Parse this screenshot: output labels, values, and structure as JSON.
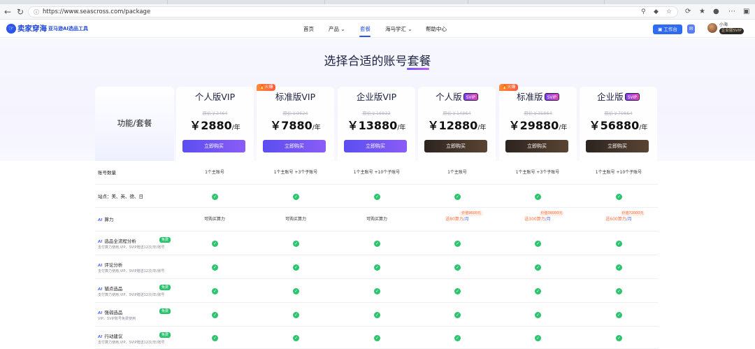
{
  "browser": {
    "url": "https://www.seascross.com/package",
    "icons": [
      "back-icon",
      "reload-icon",
      "site-info-icon",
      "zoom-icon",
      "extension-icon",
      "star-icon",
      "refresh-icon",
      "favorites-icon",
      "profile-icon",
      "more-icon",
      "sidebar-icon"
    ]
  },
  "header": {
    "logo_text": "卖家穿海",
    "logo_sub": "亚马逊AI选品工具",
    "nav": [
      {
        "label": "首页",
        "active": false
      },
      {
        "label": "产品",
        "active": false,
        "dropdown": true
      },
      {
        "label": "套餐",
        "active": true
      },
      {
        "label": "海马学汇",
        "active": false,
        "dropdown": true
      },
      {
        "label": "帮助中心",
        "active": false
      }
    ],
    "workbench_label": "工作台",
    "user_name": "小海",
    "user_badge": "企业版SVIP"
  },
  "page_title": "选择合适的账号套餐",
  "feature_header": "功能/套餐",
  "plans": [
    {
      "name": "个人版VIP",
      "svip": false,
      "hot": false,
      "orig_price": "原价￥3464",
      "price": "￥2880",
      "unit": "/年",
      "button": "立即购买",
      "style": "vip"
    },
    {
      "name": "标准版VIP",
      "svip": false,
      "hot": true,
      "orig_price": "原价￥9624",
      "price": "￥7880",
      "unit": "/年",
      "button": "立即购买",
      "style": "vip"
    },
    {
      "name": "企业版VIP",
      "svip": false,
      "hot": false,
      "orig_price": "原价￥16833",
      "price": "￥13880",
      "unit": "/年",
      "button": "立即购买",
      "style": "vip"
    },
    {
      "name": "个人版",
      "svip": true,
      "hot": false,
      "orig_price": "原价￥14864",
      "price": "￥12880",
      "unit": "/年",
      "button": "立即购买",
      "style": "svip"
    },
    {
      "name": "标准版",
      "svip": true,
      "hot": true,
      "orig_price": "原价￥35864",
      "price": "￥29880",
      "unit": "/年",
      "button": "立即购买",
      "style": "svip"
    },
    {
      "name": "企业版",
      "svip": true,
      "hot": false,
      "orig_price": "原价￥70864",
      "price": "￥56880",
      "unit": "/年",
      "button": "立即购买",
      "style": "svip"
    }
  ],
  "hot_label": "火爆",
  "svip_label": "SVIP",
  "rows": [
    {
      "label": "账号数量",
      "type": "text",
      "values": [
        "1个主账号",
        "1个主账号 +3个子账号",
        "1个主账号 +10个子账号",
        "1个主账号",
        "1个主账号 +3个子账号",
        "1个主账号 +10个子账号"
      ]
    },
    {
      "label": "站点：美、英、德、日",
      "type": "check"
    },
    {
      "label": "算力",
      "ai": true,
      "type": "credit",
      "values": [
        "可购买算力",
        "可购买算力",
        "可购买算力"
      ],
      "svip": [
        {
          "tag": "价值9600元",
          "prefix": "送80算力",
          "suffix": "/月"
        },
        {
          "tag": "价值36000元",
          "prefix": "送300算力",
          "suffix": "/月"
        },
        {
          "tag": "价值72000元",
          "prefix": "送600算力",
          "suffix": "/月"
        }
      ]
    },
    {
      "label": "选品全流程分析",
      "ai": true,
      "free": true,
      "sub": "支付算力使用,VIP、SVIP赠送12次/年/账号",
      "type": "check"
    },
    {
      "label": "评论分析",
      "ai": true,
      "free": false,
      "sub": "支付算力使用,VIP、SVIP赠送12次/年/账号",
      "type": "check"
    },
    {
      "label": "辅点选品",
      "ai": true,
      "free": true,
      "sub": "支付算力使用,VIP、SVIP赠送12次/年/账号",
      "type": "check"
    },
    {
      "label": "强弱选品",
      "ai": true,
      "free": true,
      "sub": "VIP、SVIP账号免费使用",
      "type": "check"
    },
    {
      "label": "行动建议",
      "ai": true,
      "free": true,
      "sub": "支付算力使用,VIP、SVIP赠送12次/年/账号",
      "type": "check"
    }
  ],
  "free_label": "免费",
  "ai_label": "AI"
}
